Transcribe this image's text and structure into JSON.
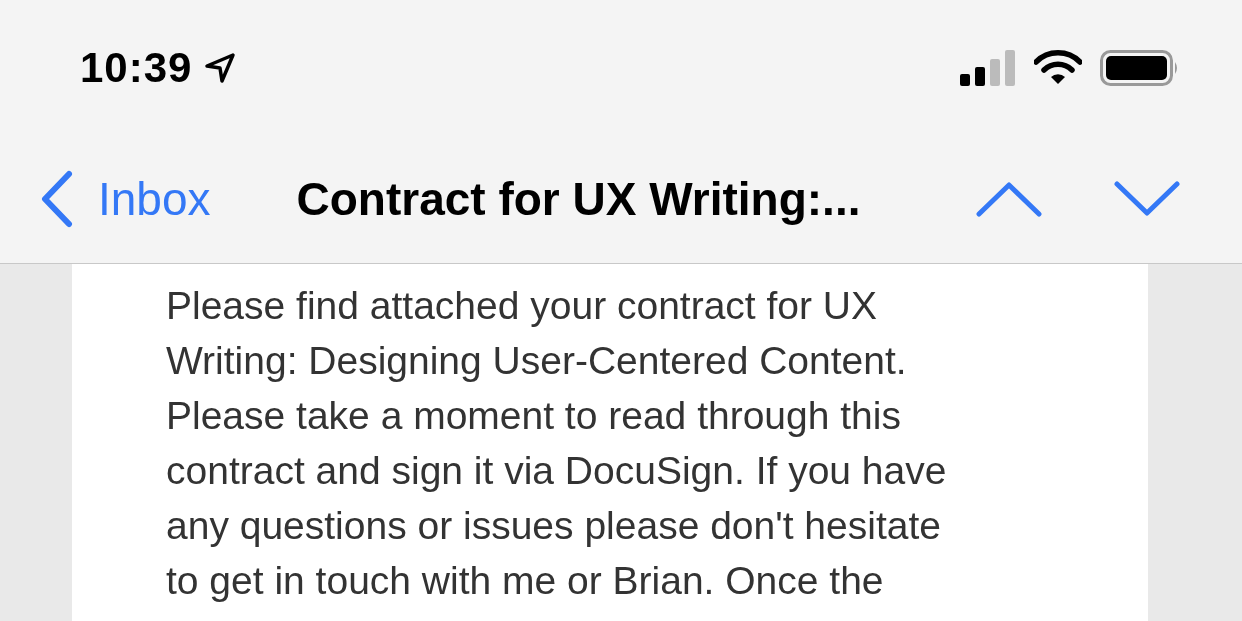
{
  "status_bar": {
    "time": "10:39"
  },
  "nav_bar": {
    "back_label": "Inbox",
    "title": "Contract for UX Writing:..."
  },
  "message": {
    "body_lines": [
      "Please find attached your contract for UX",
      "Writing: Designing User-Centered Content.",
      "Please take a moment to read through this",
      "contract and sign it via DocuSign. If you have",
      "any questions or issues please don't hesitate",
      "to get in touch with me or Brian. Once the"
    ]
  }
}
